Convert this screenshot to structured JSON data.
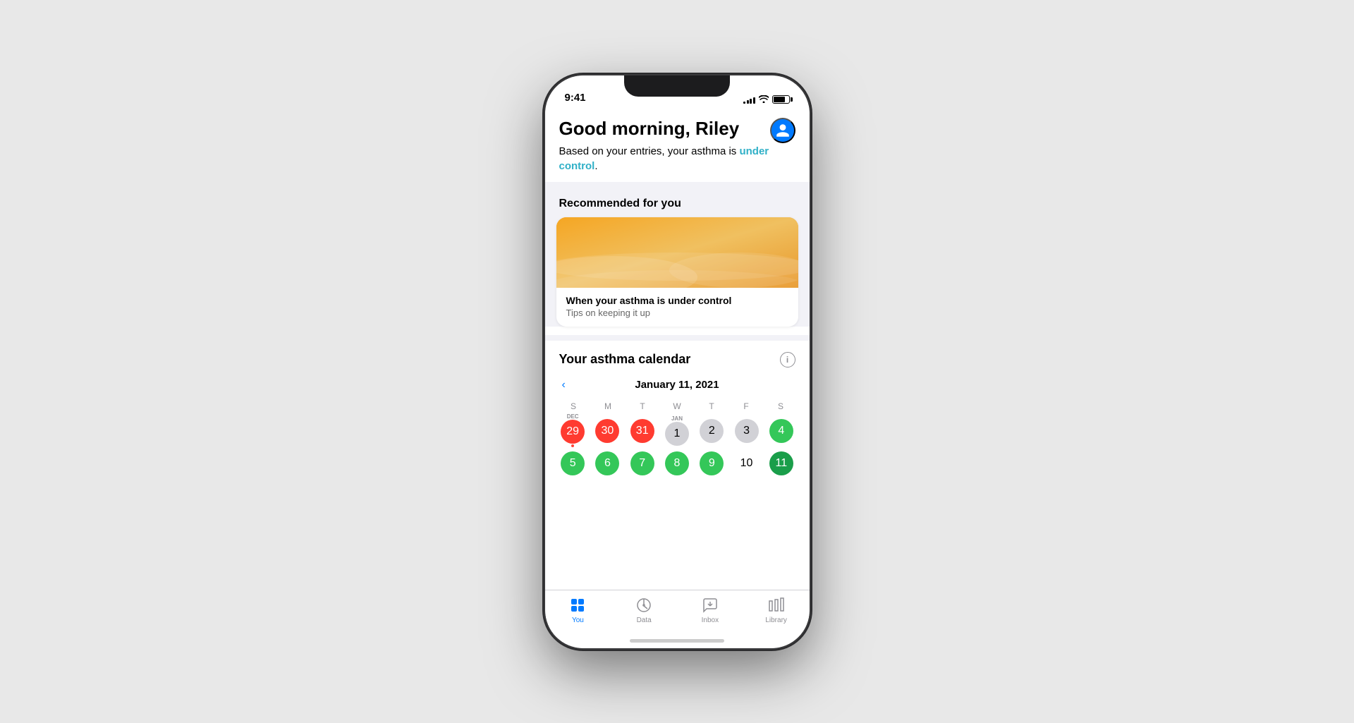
{
  "status_bar": {
    "time": "9:41",
    "signal_bars": [
      3,
      5,
      7,
      9,
      11
    ],
    "wifi": "wifi",
    "battery_pct": 80
  },
  "header": {
    "greeting": "Good morning, Riley",
    "status_text_before": "Based on your entries, your asthma is ",
    "status_link": "under control",
    "status_text_after": ".",
    "avatar_label": "profile"
  },
  "recommended": {
    "section_title": "Recommended for you",
    "card": {
      "title": "When your asthma is under control",
      "subtitle": "Tips on keeping it up"
    }
  },
  "calendar": {
    "section_title": "Your asthma calendar",
    "month_label": "January 11, 2021",
    "day_headers": [
      "S",
      "M",
      "T",
      "W",
      "T",
      "F",
      "S"
    ],
    "weeks": [
      [
        {
          "num": "29",
          "prefix": "DEC",
          "style": "red",
          "dot": true
        },
        {
          "num": "30",
          "style": "red",
          "dot": false
        },
        {
          "num": "31",
          "style": "red",
          "dot": false
        },
        {
          "num": "1",
          "prefix": "JAN",
          "style": "gray",
          "dot": false
        },
        {
          "num": "2",
          "style": "gray-text",
          "dot": false
        },
        {
          "num": "3",
          "style": "gray-text",
          "dot": false
        },
        {
          "num": "4",
          "style": "teal",
          "dot": false
        }
      ],
      [
        {
          "num": "5",
          "style": "teal",
          "dot": false
        },
        {
          "num": "6",
          "style": "teal",
          "dot": false
        },
        {
          "num": "7",
          "style": "teal",
          "dot": false
        },
        {
          "num": "8",
          "style": "teal",
          "dot": false
        },
        {
          "num": "9",
          "style": "teal",
          "dot": false
        },
        {
          "num": "10",
          "style": "plain",
          "dot": false
        },
        {
          "num": "11",
          "style": "teal-outlined",
          "dot": false
        }
      ]
    ]
  },
  "tab_bar": {
    "tabs": [
      {
        "id": "you",
        "label": "You",
        "active": true,
        "icon": "you-icon"
      },
      {
        "id": "data",
        "label": "Data",
        "active": false,
        "icon": "data-icon"
      },
      {
        "id": "inbox",
        "label": "Inbox",
        "active": false,
        "icon": "inbox-icon"
      },
      {
        "id": "library",
        "label": "Library",
        "active": false,
        "icon": "library-icon"
      }
    ]
  }
}
